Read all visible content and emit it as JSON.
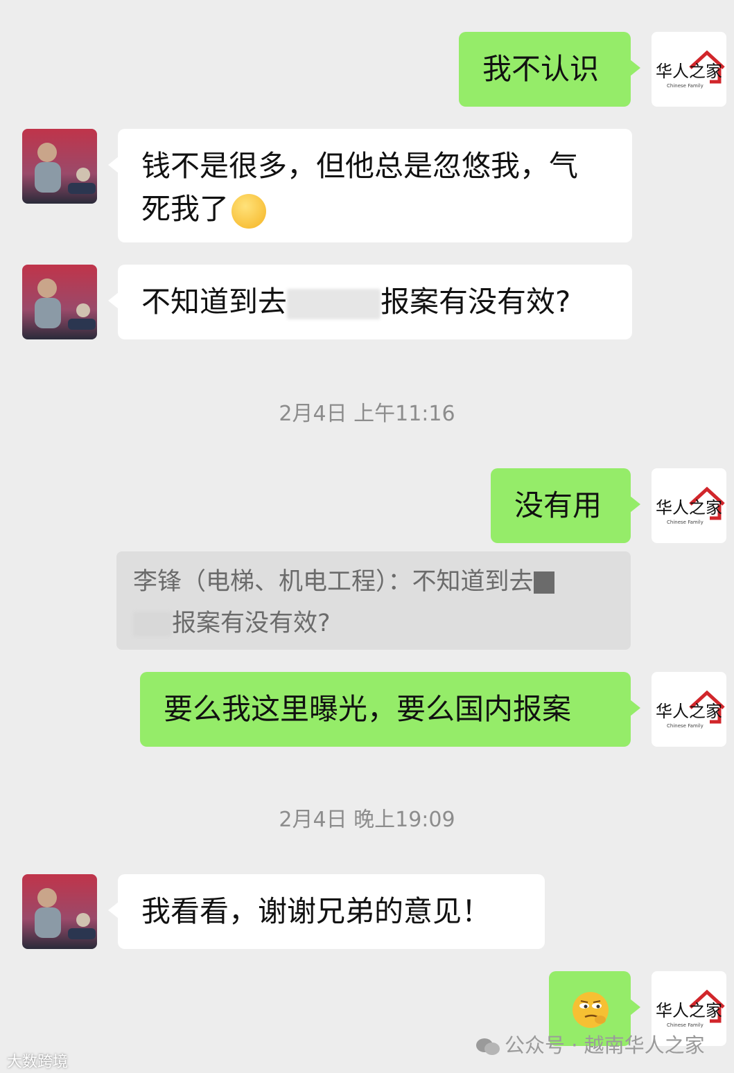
{
  "messages": [
    {
      "id": "m1",
      "text": "我不认识"
    },
    {
      "id": "m2",
      "text_line1": "钱不是很多，但他总是忽悠我，气",
      "text_line2": "死我了"
    },
    {
      "id": "m3",
      "text_before": "不知道到去",
      "text_after": "报案有没有效?"
    },
    {
      "id": "m4",
      "text": "没有用"
    },
    {
      "id": "m5",
      "text": "要么我这里曝光，要么国内报案"
    },
    {
      "id": "m6",
      "text": "我看看，谢谢兄弟的意见！"
    }
  ],
  "timestamps": [
    "2月4日 上午11:16",
    "2月4日 晚上19:09"
  ],
  "quote": {
    "line1": "李锋（电梯、机电工程）：不知道到去",
    "line2": "报案有没有效?"
  },
  "self_avatar": {
    "logo_text": "华人之家",
    "logo_sub": "Chinese Family"
  },
  "watermark": {
    "text": "公众号 · 越南华人之家",
    "left_text": "大数跨境"
  },
  "colors": {
    "background": "#ededed",
    "my_bubble": "#95ec69",
    "their_bubble": "#ffffff",
    "brand_red": "#d1262b"
  }
}
